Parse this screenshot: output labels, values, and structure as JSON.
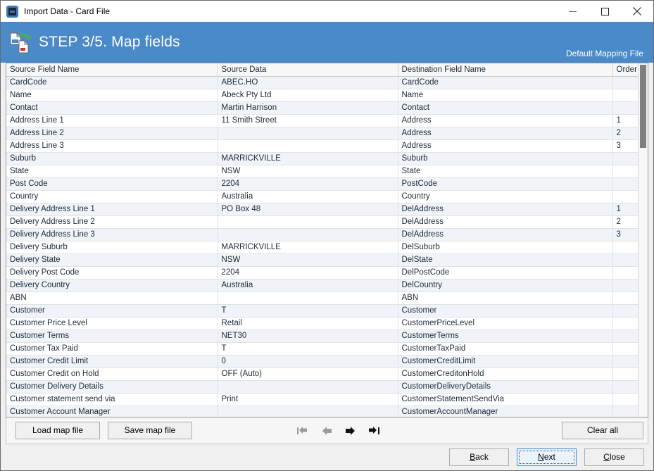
{
  "window": {
    "title": "Import Data - Card File",
    "icon": "app-logo-icon",
    "controls": {
      "minimize": "minimize-icon",
      "maximize": "maximize-icon",
      "close": "close-icon"
    }
  },
  "header": {
    "icon": "import-data-icon",
    "title": "STEP 3/5. Map fields",
    "right_label": "Default Mapping File",
    "accent_color": "#4a8ac9"
  },
  "grid": {
    "columns": [
      "Source Field Name",
      "Source Data",
      "Destination Field Name",
      "Order"
    ],
    "rows": [
      [
        "CardCode",
        "ABEC.HO",
        "CardCode",
        ""
      ],
      [
        "Name",
        "Abeck Pty Ltd",
        "Name",
        ""
      ],
      [
        "Contact",
        "Martin Harrison",
        "Contact",
        ""
      ],
      [
        "Address Line 1",
        "11 Smith Street",
        "Address",
        "1"
      ],
      [
        "Address Line 2",
        "",
        "Address",
        "2"
      ],
      [
        "Address Line 3",
        "",
        "Address",
        "3"
      ],
      [
        "Suburb",
        "MARRICKVILLE",
        "Suburb",
        ""
      ],
      [
        "State",
        "NSW",
        "State",
        ""
      ],
      [
        "Post Code",
        "2204",
        "PostCode",
        ""
      ],
      [
        "Country",
        "Australia",
        "Country",
        ""
      ],
      [
        "Delivery Address Line 1",
        "PO Box 48",
        "DelAddress",
        "1"
      ],
      [
        "Delivery Address Line 2",
        "",
        "DelAddress",
        "2"
      ],
      [
        "Delivery Address Line 3",
        "",
        "DelAddress",
        "3"
      ],
      [
        "Delivery Suburb",
        "MARRICKVILLE",
        "DelSuburb",
        ""
      ],
      [
        "Delivery State",
        "NSW",
        "DelState",
        ""
      ],
      [
        "Delivery Post Code",
        "2204",
        "DelPostCode",
        ""
      ],
      [
        "Delivery Country",
        "Australia",
        "DelCountry",
        ""
      ],
      [
        "ABN",
        "",
        "ABN",
        ""
      ],
      [
        "Customer",
        "T",
        "Customer",
        ""
      ],
      [
        "Customer Price Level",
        "Retail",
        "CustomerPriceLevel",
        ""
      ],
      [
        "Customer Terms",
        "NET30",
        "CustomerTerms",
        ""
      ],
      [
        "Customer Tax Paid",
        "T",
        "CustomerTaxPaid",
        ""
      ],
      [
        "Customer Credit Limit",
        "0",
        "CustomerCreditLimit",
        ""
      ],
      [
        "Customer Credit on Hold",
        "OFF (Auto)",
        "CustomerCreditonHold",
        ""
      ],
      [
        "Customer Delivery Details",
        "",
        "CustomerDeliveryDetails",
        ""
      ],
      [
        "Customer statement send via",
        "Print",
        "CustomerStatementSendVia",
        ""
      ],
      [
        "Customer Account Manager",
        "",
        "CustomerAccountManager",
        ""
      ]
    ]
  },
  "toolbar": {
    "load_map_file": "Load map file",
    "save_map_file": "Save map file",
    "clear_all": "Clear all",
    "nav": {
      "first": "first-record-icon",
      "previous": "previous-record-icon",
      "next": "next-record-icon",
      "last": "last-record-icon"
    }
  },
  "footer": {
    "back": "Back",
    "back_accel": "B",
    "next": "Next",
    "next_accel": "N",
    "close": "Close",
    "close_accel": "C",
    "focused_button": "Next"
  }
}
